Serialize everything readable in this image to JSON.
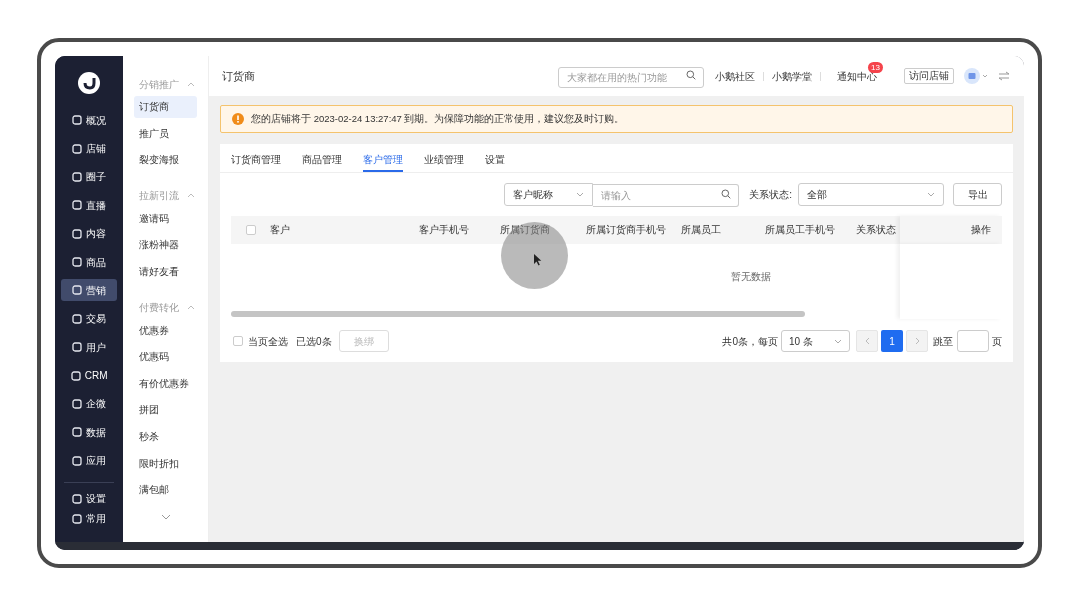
{
  "nav": {
    "items": [
      {
        "label": "概况",
        "selected": false
      },
      {
        "label": "店铺",
        "selected": false
      },
      {
        "label": "圈子",
        "selected": false
      },
      {
        "label": "直播",
        "selected": false
      },
      {
        "label": "内容",
        "selected": false
      },
      {
        "label": "商品",
        "selected": false
      },
      {
        "label": "营销",
        "selected": true
      },
      {
        "label": "交易",
        "selected": false
      },
      {
        "label": "用户",
        "selected": false
      },
      {
        "label": "CRM",
        "selected": false
      },
      {
        "label": "企微",
        "selected": false
      },
      {
        "label": "数据",
        "selected": false
      },
      {
        "label": "应用",
        "selected": false
      }
    ],
    "bottom_items": [
      {
        "label": "设置"
      },
      {
        "label": "常用"
      }
    ]
  },
  "submenu": {
    "groups": [
      {
        "title": "分销推广",
        "expanded": true,
        "items": [
          {
            "label": "订货商",
            "selected": true
          },
          {
            "label": "推广员",
            "selected": false
          },
          {
            "label": "裂变海报",
            "selected": false
          }
        ]
      },
      {
        "title": "拉新引流",
        "expanded": true,
        "items": [
          {
            "label": "邀请码",
            "selected": false
          },
          {
            "label": "涨粉神器",
            "selected": false
          },
          {
            "label": "请好友看",
            "selected": false
          }
        ]
      },
      {
        "title": "付费转化",
        "expanded": true,
        "items": [
          {
            "label": "优惠券",
            "selected": false
          },
          {
            "label": "优惠码",
            "selected": false
          },
          {
            "label": "有价优惠券",
            "selected": false
          },
          {
            "label": "拼团",
            "selected": false
          },
          {
            "label": "秒杀",
            "selected": false
          },
          {
            "label": "限时折扣",
            "selected": false
          },
          {
            "label": "满包邮",
            "selected": false
          }
        ]
      }
    ]
  },
  "header": {
    "title": "订货商",
    "search": {
      "placeholder": "大家都在用的热门功能"
    },
    "links": [
      "小鹅社区",
      "小鹅学堂"
    ],
    "notifications": {
      "label": "通知中心",
      "badge": "13"
    },
    "visit_button": "访问店铺"
  },
  "alert": {
    "text": "您的店铺将于 2023-02-24 13:27:47 到期。为保障功能的正常使用，建议您及时订购。"
  },
  "tabs": [
    {
      "label": "订货商管理",
      "selected": false
    },
    {
      "label": "商品管理",
      "selected": false
    },
    {
      "label": "客户管理",
      "selected": true
    },
    {
      "label": "业绩管理",
      "selected": false
    },
    {
      "label": "设置",
      "selected": false
    }
  ],
  "filter": {
    "field_select": "客户昵称",
    "search": {
      "placeholder": "请输入"
    },
    "status_label": "关系状态:",
    "status_select": "全部",
    "export_button": "导出"
  },
  "table": {
    "select_all_checked": false,
    "columns": [
      "客户",
      "客户手机号",
      "所属订货商",
      "所属订货商手机号",
      "所属员工",
      "所属员工手机号",
      "关系状态",
      "操作"
    ],
    "empty_text": "暂无数据"
  },
  "footer": {
    "page_select_all": {
      "label": "当页全选",
      "checked": false
    },
    "selected_count": "已选0条",
    "rebind_button": {
      "label": "换绑",
      "disabled": true
    },
    "total": "共0条，每页",
    "page_size": "10 条",
    "pages": [
      {
        "label": "1",
        "selected": true
      }
    ],
    "prev_disabled": true,
    "next_disabled": true,
    "jump_label": "跳至",
    "jump_suffix": "页"
  }
}
